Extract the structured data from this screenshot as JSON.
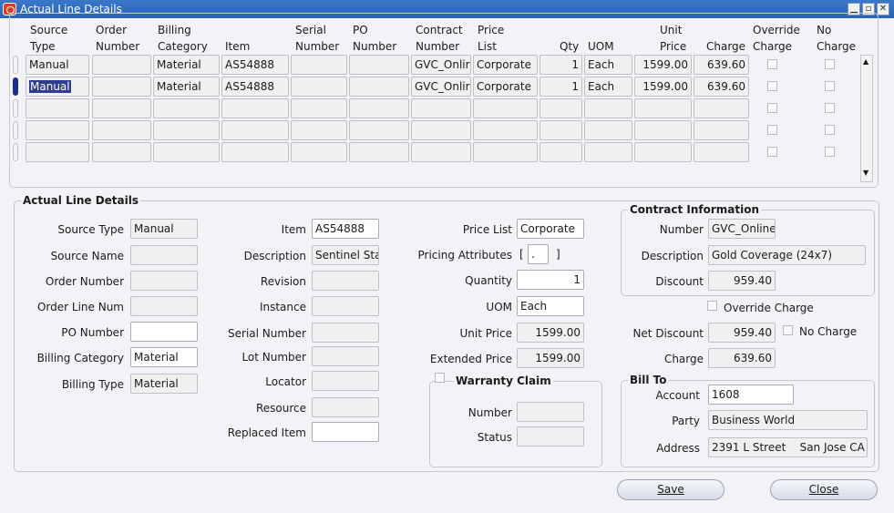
{
  "window": {
    "title": "Actual Line Details"
  },
  "table": {
    "columns": [
      {
        "key": "source_type",
        "label": "Source\nType"
      },
      {
        "key": "order_number",
        "label": "Order\nNumber"
      },
      {
        "key": "billing_category",
        "label": "Billing\nCategory"
      },
      {
        "key": "item",
        "label": "Item"
      },
      {
        "key": "serial_number",
        "label": "Serial\nNumber"
      },
      {
        "key": "po_number",
        "label": "PO\nNumber"
      },
      {
        "key": "contract_number",
        "label": "Contract\nNumber"
      },
      {
        "key": "price_list",
        "label": "Price\nList"
      },
      {
        "key": "qty",
        "label": "Qty"
      },
      {
        "key": "uom",
        "label": "UOM"
      },
      {
        "key": "unit_price",
        "label": "Unit\nPrice"
      },
      {
        "key": "charge",
        "label": "Charge"
      },
      {
        "key": "override_charge",
        "label": "Override\nCharge"
      },
      {
        "key": "no_charge",
        "label": "No\nCharge"
      }
    ],
    "rows": [
      {
        "source_type": "Manual",
        "order_number": "",
        "billing_category": "Material",
        "item": "AS54888",
        "serial_number": "",
        "po_number": "",
        "contract_number": "GVC_Onlir",
        "price_list": "Corporate",
        "qty": "1",
        "uom": "Each",
        "unit_price": "1599.00",
        "charge": "639.60"
      },
      {
        "source_type": "Manual",
        "order_number": "",
        "billing_category": "Material",
        "item": "AS54888",
        "serial_number": "",
        "po_number": "",
        "contract_number": "GVC_Onlir",
        "price_list": "Corporate",
        "qty": "1",
        "uom": "Each",
        "unit_price": "1599.00",
        "charge": "639.60"
      },
      {},
      {},
      {}
    ],
    "selected_row": 1
  },
  "details": {
    "section_title": "Actual Line Details",
    "col1": {
      "source_type": {
        "label": "Source Type",
        "value": "Manual"
      },
      "source_name": {
        "label": "Source Name",
        "value": ""
      },
      "order_number": {
        "label": "Order Number",
        "value": ""
      },
      "order_line_num": {
        "label": "Order Line Num",
        "value": ""
      },
      "po_number": {
        "label": "PO Number",
        "value": ""
      },
      "billing_category": {
        "label": "Billing Category",
        "value": "Material"
      },
      "billing_type": {
        "label": "Billing Type",
        "value": "Material"
      }
    },
    "col2": {
      "item": {
        "label": "Item",
        "value": "AS54888"
      },
      "description": {
        "label": "Description",
        "value": "Sentinel Sta"
      },
      "revision": {
        "label": "Revision",
        "value": ""
      },
      "instance": {
        "label": "Instance",
        "value": ""
      },
      "serial_number": {
        "label": "Serial Number",
        "value": ""
      },
      "lot_number": {
        "label": "Lot Number",
        "value": ""
      },
      "locator": {
        "label": "Locator",
        "value": ""
      },
      "resource": {
        "label": "Resource",
        "value": ""
      },
      "replaced_item": {
        "label": "Replaced Item",
        "value": ""
      }
    },
    "col3": {
      "price_list": {
        "label": "Price List",
        "value": "Corporate"
      },
      "pricing_attributes": {
        "label": "Pricing Attributes",
        "value": "."
      },
      "quantity": {
        "label": "Quantity",
        "value": "1"
      },
      "uom": {
        "label": "UOM",
        "value": "Each"
      },
      "unit_price": {
        "label": "Unit Price",
        "value": "1599.00"
      },
      "extended_price": {
        "label": "Extended Price",
        "value": "1599.00"
      }
    },
    "warranty": {
      "title": "Warranty Claim",
      "number": {
        "label": "Number",
        "value": ""
      },
      "status": {
        "label": "Status",
        "value": ""
      }
    },
    "contract": {
      "title": "Contract Information",
      "number": {
        "label": "Number",
        "value": "GVC_Online"
      },
      "description": {
        "label": "Description",
        "value": "Gold Coverage (24x7)"
      },
      "discount": {
        "label": "Discount",
        "value": "959.40"
      },
      "override_charge": "Override Charge",
      "net_discount": {
        "label": "Net Discount",
        "value": "959.40"
      },
      "no_charge": "No Charge",
      "charge": {
        "label": "Charge",
        "value": "639.60"
      }
    },
    "bill_to": {
      "title": "Bill To",
      "account": {
        "label": "Account",
        "value": "1608"
      },
      "party": {
        "label": "Party",
        "value": "Business World"
      },
      "address": {
        "label": "Address",
        "value": "2391 L Street    San Jose CA"
      }
    }
  },
  "buttons": {
    "save": "Save",
    "close": "Close"
  }
}
